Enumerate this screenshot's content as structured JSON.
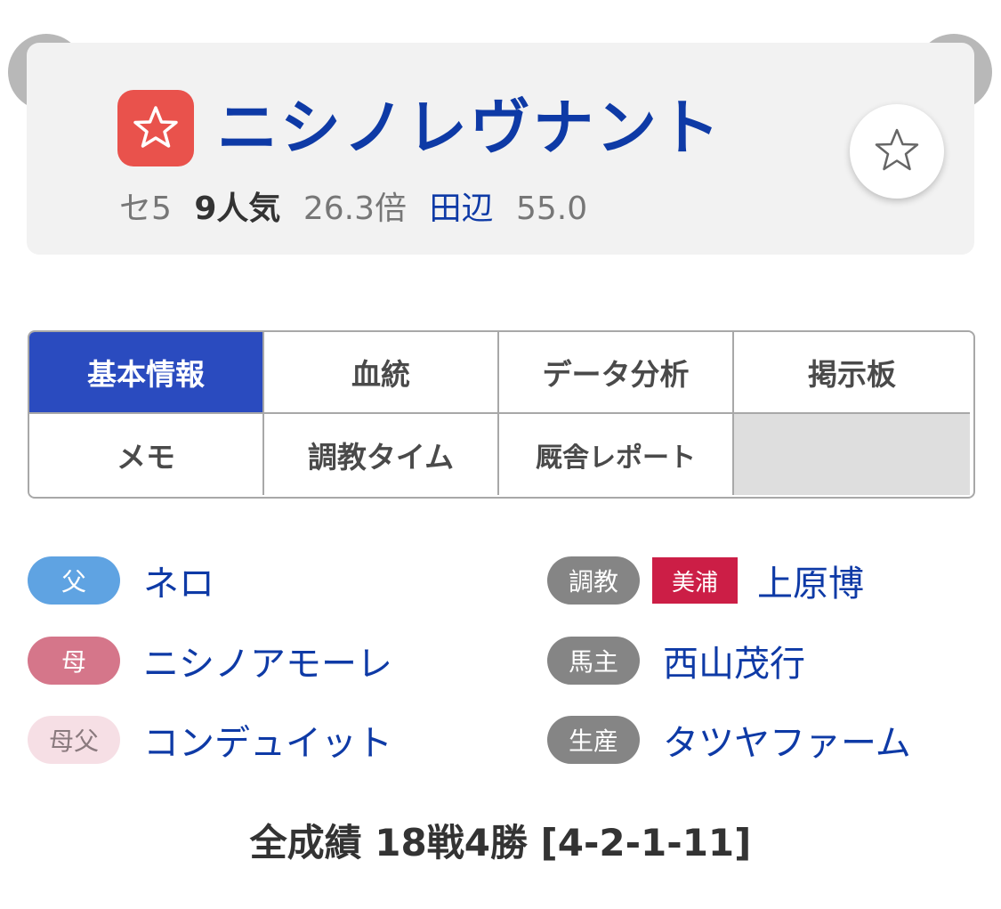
{
  "header": {
    "horse_name": "ニシノレヴナント",
    "sex_age": "セ5",
    "popularity": "9人気",
    "odds": "26.3倍",
    "jockey": "田辺",
    "weight": "55.0",
    "mark_icon": "star-outline-icon",
    "favorite_icon": "star-outline-icon",
    "prev_icon": "chevron-left-icon",
    "next_icon": "chevron-right-icon",
    "colors": {
      "name": "#0e3aa6",
      "mark_badge": "#e9524c",
      "card_bg": "#f2f2f2"
    }
  },
  "tabs": [
    {
      "label": "基本情報",
      "active": true
    },
    {
      "label": "血統",
      "active": false
    },
    {
      "label": "データ分析",
      "active": false
    },
    {
      "label": "掲示板",
      "active": false
    },
    {
      "label": "メモ",
      "active": false
    },
    {
      "label": "調教タイム",
      "active": false
    },
    {
      "label": "厩舎レポート",
      "active": false
    }
  ],
  "pedigree": {
    "sire": {
      "tag": "父",
      "name": "ネロ"
    },
    "dam": {
      "tag": "母",
      "name": "ニシノアモーレ"
    },
    "damsire": {
      "tag": "母父",
      "name": "コンデュイット"
    }
  },
  "connections": {
    "trainer": {
      "tag": "調教",
      "region": "美浦",
      "name": "上原博"
    },
    "owner": {
      "tag": "馬主",
      "name": "西山茂行"
    },
    "breeder": {
      "tag": "生産",
      "name": "タツヤファーム"
    }
  },
  "record": "全成績 18戦4勝 [4-2-1-11]",
  "colors": {
    "active_tab": "#2a4bbf",
    "link": "#0e3aa6",
    "sire_pill": "#5fa3e2",
    "dam_pill": "#d5768a",
    "damsire_pill": "#f6dfe5",
    "gray_pill": "#858585",
    "region_tag": "#cc1e46"
  }
}
